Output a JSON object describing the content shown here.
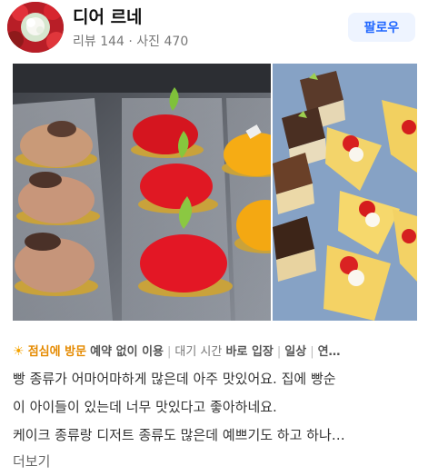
{
  "header": {
    "name": "디어 르네",
    "reviews": "리뷰 144",
    "sep": " · ",
    "photos": "사진 470",
    "follow_label": "팔로우"
  },
  "photos": [
    {
      "icon": "cake-display-photo"
    },
    {
      "icon": "dessert-slices-photo"
    }
  ],
  "tags": {
    "visit": "점심에 방문",
    "reservation": "예약 없이 이용",
    "wait_label": "대기 시간",
    "wait_value": "바로 입장",
    "purpose": "일상",
    "more": "연…"
  },
  "review": {
    "line1": "빵 종류가 어마어마하게 많은데 아주 맛있어요. 집에 빵순",
    "line2": "이 아이들이 있는데 너무 맛있다고 좋아하네요.",
    "line3": "케이크 종류랑 디저트 종류도 많은데 예쁘기도 하고 하나…",
    "more_label": "더보기"
  },
  "colors": {
    "accent": "#1f66ff",
    "visit": "#e58a00"
  }
}
